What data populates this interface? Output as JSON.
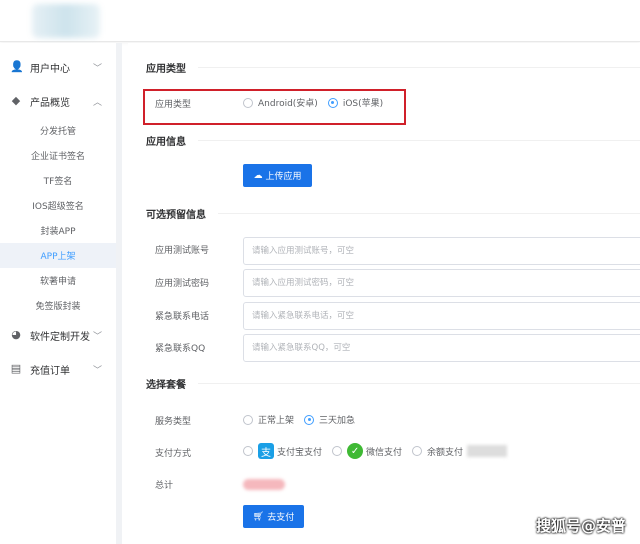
{
  "sidebar": {
    "items": [
      {
        "label": "用户中心",
        "icon": "user-icon"
      },
      {
        "label": "产品概览",
        "icon": "cube-icon"
      },
      {
        "label": "软件定制开发",
        "icon": "pie-icon"
      },
      {
        "label": "充值订单",
        "icon": "calendar-icon"
      }
    ],
    "sub_items": [
      "分发托管",
      "企业证书签名",
      "TF签名",
      "IOS超级签名",
      "封装APP",
      "APP上架",
      "软著申请",
      "免签版封装"
    ],
    "active_sub": "APP上架"
  },
  "sections": {
    "app_type": "应用类型",
    "app_info": "应用信息",
    "optional": "可选预留信息",
    "package": "选择套餐"
  },
  "app_type": {
    "label": "应用类型",
    "options": [
      "Android(安卓)",
      "iOS(苹果)"
    ],
    "selected": "iOS(苹果)"
  },
  "upload_button": "上传应用",
  "fields": [
    {
      "label": "应用测试账号",
      "placeholder": "请输入应用测试账号，可空"
    },
    {
      "label": "应用测试密码",
      "placeholder": "请输入应用测试密码，可空"
    },
    {
      "label": "紧急联系电话",
      "placeholder": "请输入紧急联系电话，可空"
    },
    {
      "label": "紧急联系QQ",
      "placeholder": "请输入紧急联系QQ，可空"
    }
  ],
  "service": {
    "label": "服务类型",
    "options": [
      "正常上架",
      "三天加急"
    ],
    "selected": "三天加急"
  },
  "payment": {
    "label": "支付方式",
    "options": [
      "支付宝支付",
      "微信支付",
      "余额支付"
    ]
  },
  "total": {
    "label": "总计"
  },
  "pay_button": "去支付",
  "watermark": "搜狐号@安普",
  "colors": {
    "primary": "#1a73e8",
    "highlight": "#d0202a"
  }
}
